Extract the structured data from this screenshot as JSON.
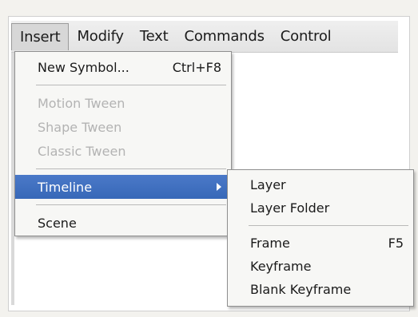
{
  "menubar": {
    "items": [
      {
        "label": "Insert",
        "active": true
      },
      {
        "label": "Modify"
      },
      {
        "label": "Text"
      },
      {
        "label": "Commands"
      },
      {
        "label": "Control"
      }
    ]
  },
  "insert_menu": {
    "new_symbol": {
      "label": "New Symbol...",
      "shortcut": "Ctrl+F8"
    },
    "motion_tween": {
      "label": "Motion Tween"
    },
    "shape_tween": {
      "label": "Shape Tween"
    },
    "classic_tween": {
      "label": "Classic Tween"
    },
    "timeline": {
      "label": "Timeline"
    },
    "scene": {
      "label": "Scene"
    }
  },
  "timeline_submenu": {
    "layer": {
      "label": "Layer"
    },
    "layer_folder": {
      "label": "Layer Folder"
    },
    "frame": {
      "label": "Frame",
      "shortcut": "F5"
    },
    "keyframe": {
      "label": "Keyframe"
    },
    "blank_keyframe": {
      "label": "Blank Keyframe"
    }
  },
  "colors": {
    "highlight": "#3e6fbe",
    "disabled_text": "#b3b3b3"
  }
}
